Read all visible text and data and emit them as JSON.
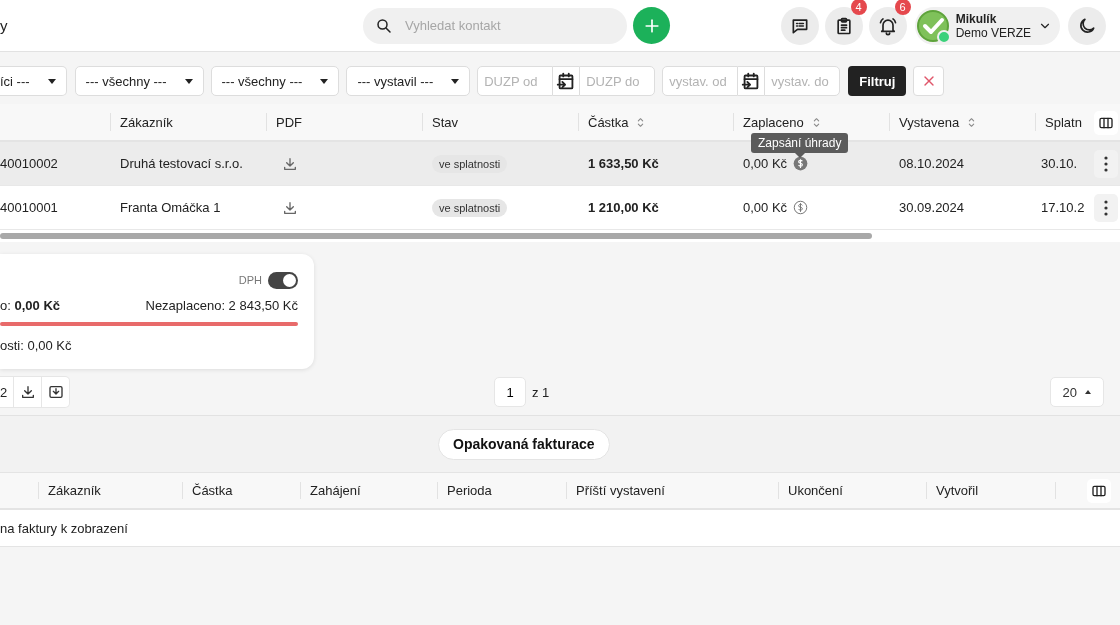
{
  "header": {
    "title": "y",
    "search": {
      "placeholder": "Vyhledat kontakt"
    },
    "actions": [
      {
        "kind": "chat"
      },
      {
        "kind": "clipboard",
        "badge": "4"
      },
      {
        "kind": "bell",
        "badge": "6"
      }
    ],
    "user": {
      "name": "Mikulík",
      "subtitle": "Demo VERZE",
      "online": true
    }
  },
  "filters": {
    "selects": [
      "íci ---",
      "--- všechny ---",
      "--- všechny ---",
      "--- vystavil ---"
    ],
    "date_ranges": [
      {
        "from_placeholder": "DUZP od",
        "to_placeholder": "DUZP do"
      },
      {
        "from_placeholder": "vystav. od",
        "to_placeholder": "vystav. do"
      }
    ],
    "filter_button": "Filtruj"
  },
  "invoices": {
    "columns": [
      {
        "label": "Zákazník",
        "sortable": false
      },
      {
        "label": "PDF",
        "sortable": false
      },
      {
        "label": "Stav",
        "sortable": false
      },
      {
        "label": "Částka",
        "sortable": true
      },
      {
        "label": "Zaplaceno",
        "sortable": true
      },
      {
        "label": "Vystavena",
        "sortable": true
      },
      {
        "label": "Splatn",
        "sortable": false
      }
    ],
    "rows": [
      {
        "number": "40010002",
        "customer": "Druhá testovací s.r.o.",
        "status": "ve splatnosti",
        "amount": "1 633,50 Kč",
        "paid": "0,00 Kč",
        "issued": "08.10.2024",
        "due": "30.10.",
        "hovered": true
      },
      {
        "number": "40010001",
        "customer": "Franta Omáčka 1",
        "status": "ve splatnosti",
        "amount": "1 210,00 Kč",
        "paid": "0,00 Kč",
        "issued": "30.09.2024",
        "due": "17.10.2",
        "hovered": false
      }
    ],
    "tooltip": "Zapsání úhrady"
  },
  "summary": {
    "vat_label": "DPH",
    "vat_on": true,
    "paid": "o: **0,00 Kč**",
    "unpaid": "Nezaplaceno: 2 843,50 Kč",
    "level": 1,
    "overdue": "osti: 0,00 Kč"
  },
  "pager": {
    "count": "2",
    "page": "1",
    "of": "z 1",
    "page_size": "20"
  },
  "recurring": {
    "title": "Opakovaná fakturace",
    "columns": [
      "Zákazník",
      "Částka",
      "Zahájení",
      "Perioda",
      "Příští vystavení",
      "Ukončení",
      "Vytvořil"
    ],
    "empty": "na faktury k zobrazení"
  }
}
